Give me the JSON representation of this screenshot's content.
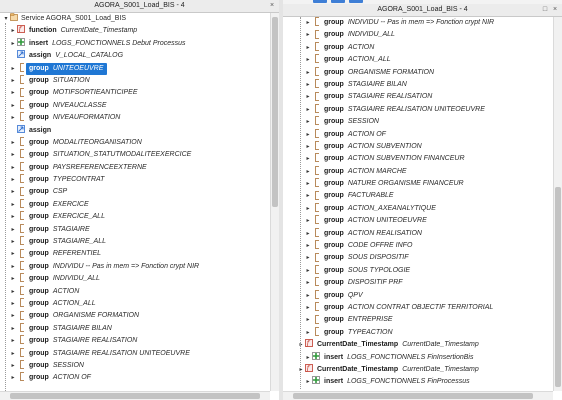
{
  "left_pane": {
    "title": "AGORA_S001_Load_BIS - 4",
    "rows": [
      {
        "indent": 0,
        "expander": "▾",
        "icon": "service-icon",
        "kind": "",
        "name": "Service AGORA_S001_Load_BIS",
        "bold_name": false
      },
      {
        "indent": 1,
        "expander": "▸",
        "icon": "function-icon",
        "kind": "function",
        "name": "CurrentDate_Timestamp"
      },
      {
        "indent": 1,
        "expander": "▸",
        "icon": "insert-icon",
        "kind": "insert",
        "name": "LOGS_FONCTIONNELS Debut Processus"
      },
      {
        "indent": 1,
        "expander": "",
        "icon": "assign-icon",
        "kind": "assign",
        "name": "V_LOCAL_CATALOG"
      },
      {
        "indent": 1,
        "expander": "▸",
        "icon": "group-icon",
        "kind": "group",
        "name": "UNITEOEUVRE",
        "selected": true
      },
      {
        "indent": 1,
        "expander": "▸",
        "icon": "group-icon",
        "kind": "group",
        "name": "SITUATION"
      },
      {
        "indent": 1,
        "expander": "▸",
        "icon": "group-icon",
        "kind": "group",
        "name": "MOTIFSORTIEANTICIPEE"
      },
      {
        "indent": 1,
        "expander": "▸",
        "icon": "group-icon",
        "kind": "group",
        "name": "NIVEAUCLASSE"
      },
      {
        "indent": 1,
        "expander": "▸",
        "icon": "group-icon",
        "kind": "group",
        "name": "NIVEAUFORMATION"
      },
      {
        "indent": 1,
        "expander": "",
        "icon": "assign-icon",
        "kind": "assign",
        "name": ""
      },
      {
        "indent": 1,
        "expander": "▸",
        "icon": "group-icon",
        "kind": "group",
        "name": "MODALITEORGANISATION"
      },
      {
        "indent": 1,
        "expander": "▸",
        "icon": "group-icon",
        "kind": "group",
        "name": "SITUATION_STATUTMODALITEEXERCICE"
      },
      {
        "indent": 1,
        "expander": "▸",
        "icon": "group-icon",
        "kind": "group",
        "name": "PAYSREFERENCEEXTERNE"
      },
      {
        "indent": 1,
        "expander": "▸",
        "icon": "group-icon",
        "kind": "group",
        "name": "TYPECONTRAT"
      },
      {
        "indent": 1,
        "expander": "▸",
        "icon": "group-icon",
        "kind": "group",
        "name": "CSP"
      },
      {
        "indent": 1,
        "expander": "▸",
        "icon": "group-icon",
        "kind": "group",
        "name": "EXERCICE"
      },
      {
        "indent": 1,
        "expander": "▸",
        "icon": "group-icon",
        "kind": "group",
        "name": "EXERCICE_ALL"
      },
      {
        "indent": 1,
        "expander": "▸",
        "icon": "group-icon",
        "kind": "group",
        "name": "STAGIAIRE"
      },
      {
        "indent": 1,
        "expander": "▸",
        "icon": "group-icon",
        "kind": "group",
        "name": "STAGIAIRE_ALL"
      },
      {
        "indent": 1,
        "expander": "▸",
        "icon": "group-icon",
        "kind": "group",
        "name": "REFERENTIEL"
      },
      {
        "indent": 1,
        "expander": "▸",
        "icon": "group-icon",
        "kind": "group",
        "name": "INDIVIDU -- Pas in mem => Fonction crypt NIR"
      },
      {
        "indent": 1,
        "expander": "▸",
        "icon": "group-icon",
        "kind": "group",
        "name": "INDIVIDU_ALL"
      },
      {
        "indent": 1,
        "expander": "▸",
        "icon": "group-icon",
        "kind": "group",
        "name": "ACTION"
      },
      {
        "indent": 1,
        "expander": "▸",
        "icon": "group-icon",
        "kind": "group",
        "name": "ACTION_ALL"
      },
      {
        "indent": 1,
        "expander": "▸",
        "icon": "group-icon",
        "kind": "group",
        "name": "ORGANISME FORMATION"
      },
      {
        "indent": 1,
        "expander": "▸",
        "icon": "group-icon",
        "kind": "group",
        "name": "STAGIAIRE BILAN"
      },
      {
        "indent": 1,
        "expander": "▸",
        "icon": "group-icon",
        "kind": "group",
        "name": "STAGIAIRE REALISATION"
      },
      {
        "indent": 1,
        "expander": "▸",
        "icon": "group-icon",
        "kind": "group",
        "name": "STAGIAIRE REALISATION UNITEOEUVRE"
      },
      {
        "indent": 1,
        "expander": "▸",
        "icon": "group-icon",
        "kind": "group",
        "name": "SESSION"
      },
      {
        "indent": 1,
        "expander": "▸",
        "icon": "group-icon",
        "kind": "group",
        "name": "ACTION OF"
      }
    ]
  },
  "right_pane": {
    "title": "AGORA_S001_Load_BIS - 4",
    "rows": [
      {
        "indent": 1,
        "expander": "▸",
        "icon": "group-icon",
        "kind": "group",
        "name": "INDIVIDU -- Pas in mem => Fonction crypt NIR"
      },
      {
        "indent": 1,
        "expander": "▸",
        "icon": "group-icon",
        "kind": "group",
        "name": "INDIVIDU_ALL"
      },
      {
        "indent": 1,
        "expander": "▸",
        "icon": "group-icon",
        "kind": "group",
        "name": "ACTION"
      },
      {
        "indent": 1,
        "expander": "▸",
        "icon": "group-icon",
        "kind": "group",
        "name": "ACTION_ALL"
      },
      {
        "indent": 1,
        "expander": "▸",
        "icon": "group-icon",
        "kind": "group",
        "name": "ORGANISME FORMATION"
      },
      {
        "indent": 1,
        "expander": "▸",
        "icon": "group-icon",
        "kind": "group",
        "name": "STAGIAIRE BILAN"
      },
      {
        "indent": 1,
        "expander": "▸",
        "icon": "group-icon",
        "kind": "group",
        "name": "STAGIAIRE REALISATION"
      },
      {
        "indent": 1,
        "expander": "▸",
        "icon": "group-icon",
        "kind": "group",
        "name": "STAGIAIRE REALISATION UNITEOEUVRE"
      },
      {
        "indent": 1,
        "expander": "▸",
        "icon": "group-icon",
        "kind": "group",
        "name": "SESSION"
      },
      {
        "indent": 1,
        "expander": "▸",
        "icon": "group-icon",
        "kind": "group",
        "name": "ACTION OF"
      },
      {
        "indent": 1,
        "expander": "▸",
        "icon": "group-icon",
        "kind": "group",
        "name": "ACTION SUBVENTION"
      },
      {
        "indent": 1,
        "expander": "▸",
        "icon": "group-icon",
        "kind": "group",
        "name": "ACTION SUBVENTION FINANCEUR"
      },
      {
        "indent": 1,
        "expander": "▸",
        "icon": "group-icon",
        "kind": "group",
        "name": "ACTION MARCHE"
      },
      {
        "indent": 1,
        "expander": "▸",
        "icon": "group-icon",
        "kind": "group",
        "name": "NATURE ORGANISME FINANCEUR"
      },
      {
        "indent": 1,
        "expander": "▸",
        "icon": "group-icon",
        "kind": "group",
        "name": "FACTURABLE"
      },
      {
        "indent": 1,
        "expander": "▸",
        "icon": "group-icon",
        "kind": "group",
        "name": "ACTION_AXEANALYTIQUE"
      },
      {
        "indent": 1,
        "expander": "▸",
        "icon": "group-icon",
        "kind": "group",
        "name": "ACTION UNITEOEUVRE"
      },
      {
        "indent": 1,
        "expander": "▸",
        "icon": "group-icon",
        "kind": "group",
        "name": "ACTION REALISATION"
      },
      {
        "indent": 1,
        "expander": "▸",
        "icon": "group-icon",
        "kind": "group",
        "name": "CODE OFFRE INFO"
      },
      {
        "indent": 1,
        "expander": "▸",
        "icon": "group-icon",
        "kind": "group",
        "name": "SOUS DISPOSITIF"
      },
      {
        "indent": 1,
        "expander": "▸",
        "icon": "group-icon",
        "kind": "group",
        "name": "SOUS TYPOLOGIE"
      },
      {
        "indent": 1,
        "expander": "▸",
        "icon": "group-icon",
        "kind": "group",
        "name": "DISPOSITIF PRF"
      },
      {
        "indent": 1,
        "expander": "▸",
        "icon": "group-icon",
        "kind": "group",
        "name": "QPV"
      },
      {
        "indent": 1,
        "expander": "▸",
        "icon": "group-icon",
        "kind": "group",
        "name": "ACTION CONTRAT OBJECTIF TERRITORIAL"
      },
      {
        "indent": 1,
        "expander": "▸",
        "icon": "group-icon",
        "kind": "group",
        "name": "ENTREPRISE"
      },
      {
        "indent": 1,
        "expander": "▸",
        "icon": "group-icon",
        "kind": "group",
        "name": "TYPEACTION"
      },
      {
        "indent": 0,
        "expander": "▸",
        "icon": "function-icon",
        "kind": "CurrentDate_Timestamp",
        "name": "CurrentDate_Timestamp"
      },
      {
        "indent": 1,
        "expander": "▸",
        "icon": "insert-icon",
        "kind": "insert",
        "name": "LOGS_FONCTIONNELS FinInsertionBis"
      },
      {
        "indent": 0,
        "expander": "▸",
        "icon": "function-icon",
        "kind": "CurrentDate_Timestamp",
        "name": "CurrentDate_Timestamp"
      },
      {
        "indent": 1,
        "expander": "▸",
        "icon": "insert-icon",
        "kind": "insert",
        "name": "LOGS_FONCTIONNELS FinProcessus"
      }
    ]
  },
  "colors": {
    "selection": "#1f77d4",
    "group_bracket": "#b88a5b",
    "insert_icon": "#2f9a3a",
    "function_icon": "#c0392b",
    "assign_icon": "#2f6fd0"
  },
  "window_controls": {
    "close_label": "×",
    "maximize_label": "□"
  }
}
